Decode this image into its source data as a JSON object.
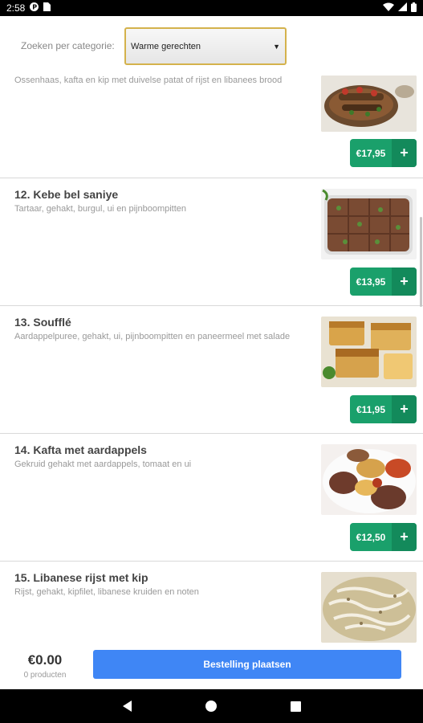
{
  "status_bar": {
    "time": "2:58",
    "left_icons": [
      "p-circle-icon",
      "sim-card-icon"
    ],
    "right_icons": [
      "wifi-icon",
      "signal-icon",
      "battery-icon"
    ]
  },
  "filter": {
    "label": "Zoeken per categorie:",
    "selected": "Warme gerechten"
  },
  "items": [
    {
      "title": "",
      "description": "Ossenhaas, kafta en kip met duivelse patat of rijst en libanees brood",
      "price": "€17,95",
      "add": "+"
    },
    {
      "title": "12. Kebe bel saniye",
      "description": "Tartaar, gehakt, burgul, ui en pijnboompitten",
      "price": "€13,95",
      "add": "+"
    },
    {
      "title": "13. Soufflé",
      "description": "Aardappelpuree, gehakt, ui, pijnboompitten en paneermeel met salade",
      "price": "€11,95",
      "add": "+"
    },
    {
      "title": "14. Kafta met aardappels",
      "description": "Gekruid gehakt met aardappels, tomaat en ui",
      "price": "€12,50",
      "add": "+"
    },
    {
      "title": "15. Libanese rijst met kip",
      "description": "Rijst, gehakt, kipfilet, libanese kruiden en noten",
      "price": "",
      "add": ""
    }
  ],
  "cart": {
    "total": "€0.00",
    "count": "0 producten",
    "order_button": "Bestelling plaatsen"
  },
  "colors": {
    "accent_green": "#1aa06b",
    "order_blue": "#3f86f5",
    "select_border": "#d4b24c"
  }
}
